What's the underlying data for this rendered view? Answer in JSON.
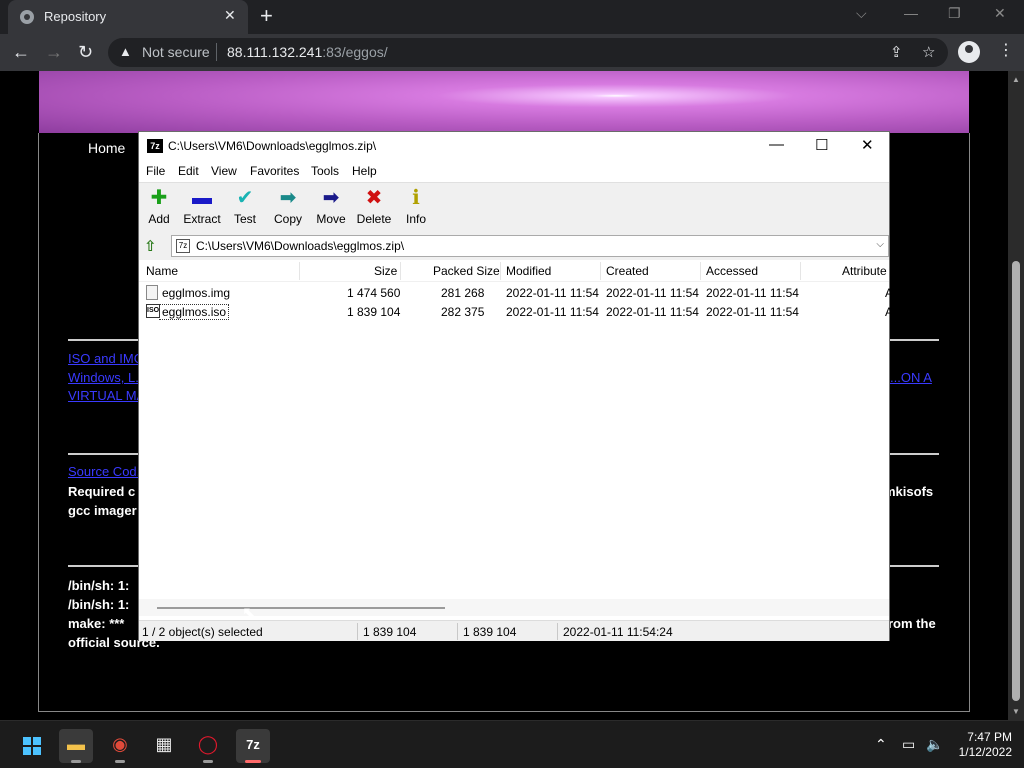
{
  "browser": {
    "tab_title": "Repository",
    "not_secure": "Not secure",
    "url_host": "88.111.132.241",
    "url_rest": ":83/eggos/"
  },
  "page": {
    "nav_home": "Home",
    "link1_line1": "ISO and IMG...",
    "link1_line2": "Windows, L...",
    "link1_line3": "VIRTUAL MA...",
    "link1_right": "...ON A",
    "source_link": "Source Cod...",
    "required_left": "Required c",
    "required_right": "mkisofs",
    "gcc_line": "gcc imager",
    "error1": "/bin/sh: 1:",
    "error2": "/bin/sh: 1:",
    "error3": "make: ***",
    "error3_right": "rom the",
    "official_source": "official source."
  },
  "sevenzip": {
    "title": "C:\\Users\\VM6\\Downloads\\egglmos.zip\\",
    "icon_text": "7z",
    "menu": [
      "File",
      "Edit",
      "View",
      "Favorites",
      "Tools",
      "Help"
    ],
    "tools": [
      {
        "label": "Add",
        "icon": "add-icon",
        "glyph": "✚",
        "color": "#1aa01a"
      },
      {
        "label": "Extract",
        "icon": "extract-icon",
        "glyph": "▬",
        "color": "#1a1ac8"
      },
      {
        "label": "Test",
        "icon": "test-icon",
        "glyph": "✔",
        "color": "#19b3b3"
      },
      {
        "label": "Copy",
        "icon": "copy-icon",
        "glyph": "➡",
        "color": "#1a8a8a"
      },
      {
        "label": "Move",
        "icon": "move-icon",
        "glyph": "➡",
        "color": "#1a1a8a"
      },
      {
        "label": "Delete",
        "icon": "delete-icon",
        "glyph": "✖",
        "color": "#d01010"
      },
      {
        "label": "Info",
        "icon": "info-icon",
        "glyph": "ℹ",
        "color": "#b0a000"
      }
    ],
    "path": "C:\\Users\\VM6\\Downloads\\egglmos.zip\\",
    "columns": {
      "name": "Name",
      "size": "Size",
      "packed": "Packed Size",
      "modified": "Modified",
      "created": "Created",
      "accessed": "Accessed",
      "attributes": "Attribute"
    },
    "rows": [
      {
        "name": "egglmos.img",
        "size": "1 474 560",
        "packed": "281 268",
        "modified": "2022-01-11 11:54",
        "created": "2022-01-11 11:54",
        "accessed": "2022-01-11 11:54",
        "attr": "A"
      },
      {
        "name": "egglmos.iso",
        "size": "1 839 104",
        "packed": "282 375",
        "modified": "2022-01-11 11:54",
        "created": "2022-01-11 11:54",
        "accessed": "2022-01-11 11:54",
        "attr": "A"
      }
    ],
    "status": {
      "selected": "1 / 2 object(s) selected",
      "size": "1 839 104",
      "packed": "1 839 104",
      "date": "2022-01-11 11:54:24"
    }
  },
  "taskbar": {
    "time": "7:47 PM",
    "date": "1/12/2022",
    "items": [
      "start-icon",
      "file-explorer-icon",
      "chrome-icon",
      "store-icon",
      "opera-icon",
      "7zip-icon"
    ]
  }
}
